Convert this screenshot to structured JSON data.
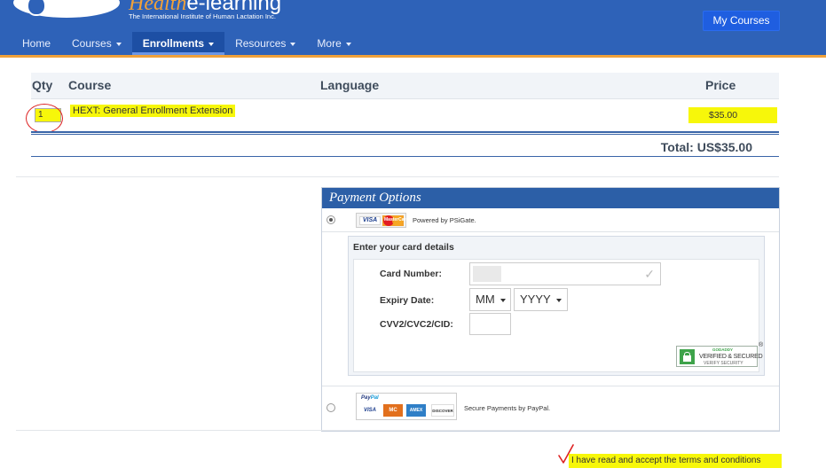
{
  "header": {
    "logo": {
      "script": "Health",
      "word": "e-learning",
      "subtitle": "The International Institute of Human Lactation Inc."
    },
    "my_courses_label": "My Courses",
    "nav": [
      {
        "label": "Home",
        "has_caret": false,
        "active": false
      },
      {
        "label": "Courses",
        "has_caret": true,
        "active": false
      },
      {
        "label": "Enrollments",
        "has_caret": true,
        "active": true
      },
      {
        "label": "Resources",
        "has_caret": true,
        "active": false
      },
      {
        "label": "More",
        "has_caret": true,
        "active": false
      }
    ]
  },
  "cart": {
    "columns": {
      "qty": "Qty",
      "course": "Course",
      "language": "Language",
      "price": "Price"
    },
    "row": {
      "qty": "1",
      "course": "HEXT: General Enrollment Extension",
      "language": "",
      "price": "$35.00"
    },
    "total": "Total: US$35.00"
  },
  "payment": {
    "title": "Payment Options",
    "psigate": {
      "selected": true,
      "visa_label": "VISA",
      "mastercard_label": "MasterCard",
      "powered_by": "Powered by PSiGate."
    },
    "card_details": {
      "heading": "Enter your card details",
      "card_number_label": "Card Number:",
      "expiry_label": "Expiry Date:",
      "month_value": "MM",
      "year_value": "YYYY",
      "cvv_label": "CVV2/CVC2/CID:"
    },
    "badge": {
      "top": "GODADDY",
      "main": "VERIFIED & SECURED",
      "sub": "VERIFY SECURITY",
      "reg": "®"
    },
    "paypal": {
      "selected": false,
      "brand_a": "Pay",
      "brand_b": "Pal",
      "cards": [
        "VISA",
        "MC",
        "AMEX",
        "DISCOVER"
      ],
      "text": "Secure Payments by PayPal."
    }
  },
  "terms": {
    "text": "I have read and accept the terms and conditions"
  },
  "colors": {
    "header_bg": "#2e62b8",
    "accent_orange": "#f0a13a",
    "highlight_yellow": "#f7f70a",
    "annotation_red": "#dd2222",
    "panel_head": "#2c5fa7"
  }
}
